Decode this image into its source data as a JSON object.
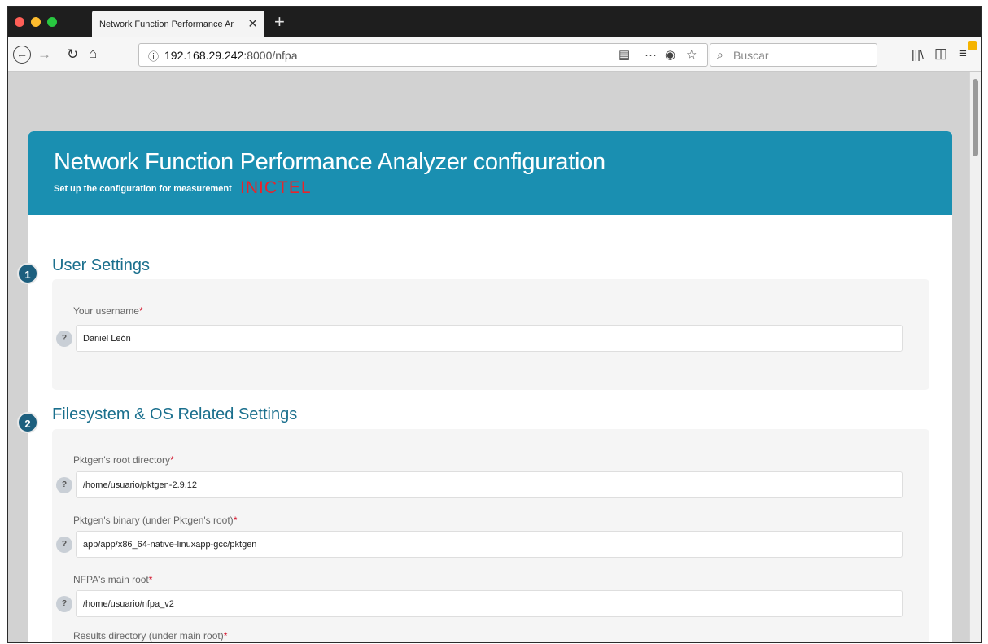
{
  "browser": {
    "tab_title": "Network Function Performance Ana",
    "tab_close_icon": "close-icon",
    "new_tab_icon": "plus-icon",
    "url_host": "192.168.29.242",
    "url_rest": ":8000/nfpa",
    "search_placeholder": "Buscar",
    "icons": [
      "back-arrow-icon",
      "forward-arrow-icon",
      "reload-icon",
      "home-icon",
      "info-icon",
      "reader-view-icon",
      "more-actions-icon",
      "pocket-icon",
      "bookmark-star-icon",
      "search-icon",
      "library-icon",
      "sidebar-icon",
      "menu-icon"
    ],
    "traffic_light_colors": [
      "#ff5f57",
      "#febc2e",
      "#28c840"
    ]
  },
  "header": {
    "title": "Network Function Performance Analyzer configuration",
    "subtitle": "Set up the configuration for measurement",
    "brand": "INICTEL",
    "bg_color": "#1a8fb1",
    "brand_color": "#e8242b"
  },
  "sections": [
    {
      "number": "1",
      "title": "User Settings",
      "fields": [
        {
          "label": "Your username",
          "required": "*",
          "help": "?",
          "value": "Daniel León"
        }
      ]
    },
    {
      "number": "2",
      "title": "Filesystem & OS Related Settings",
      "fields": [
        {
          "label": "Pktgen's root directory",
          "required": "*",
          "help": "?",
          "value": "/home/usuario/pktgen-2.9.12"
        },
        {
          "label": "Pktgen's binary (under Pktgen's root)",
          "required": "*",
          "help": "?",
          "value": "app/app/x86_64-native-linuxapp-gcc/pktgen"
        },
        {
          "label": "NFPA's main root",
          "required": "*",
          "help": "?",
          "value": "/home/usuario/nfpa_v2"
        },
        {
          "label": "Results directory (under main root)",
          "required": "*"
        }
      ]
    }
  ]
}
